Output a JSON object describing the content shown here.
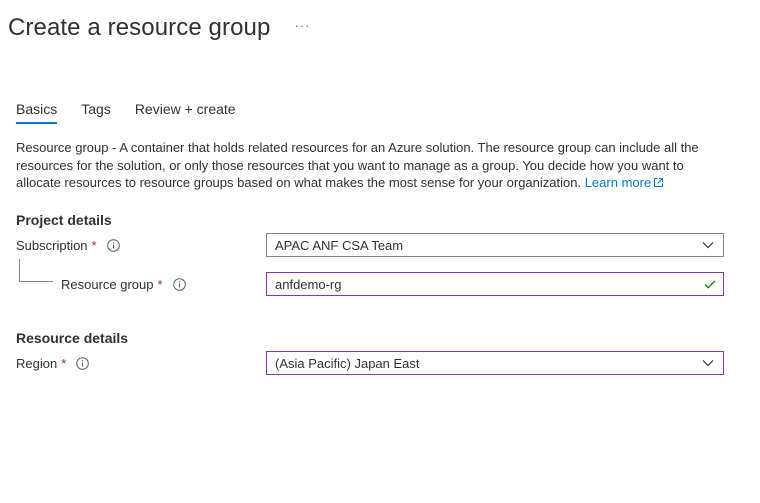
{
  "header": {
    "title": "Create a resource group",
    "more_label": "···"
  },
  "tabs": [
    {
      "label": "Basics",
      "active": true
    },
    {
      "label": "Tags",
      "active": false
    },
    {
      "label": "Review + create",
      "active": false
    }
  ],
  "description": {
    "term": "Resource group",
    "text": " - A container that holds related resources for an Azure solution. The resource group can include all the resources for the solution, or only those resources that you want to manage as a group. You decide how you want to allocate resources to resource groups based on what makes the most sense for your organization. ",
    "link_label": "Learn more"
  },
  "project_details": {
    "title": "Project details",
    "subscription": {
      "label": "Subscription",
      "required": "*",
      "value": "APAC ANF CSA Team"
    },
    "resource_group": {
      "label": "Resource group",
      "required": "*",
      "value": "anfdemo-rg"
    }
  },
  "resource_details": {
    "title": "Resource details",
    "region": {
      "label": "Region",
      "required": "*",
      "value": "(Asia Pacific) Japan East"
    }
  },
  "colors": {
    "accent": "#0078d4",
    "focus_border": "#8b32b3",
    "valid_check": "#107c10",
    "required": "#a4262c"
  }
}
